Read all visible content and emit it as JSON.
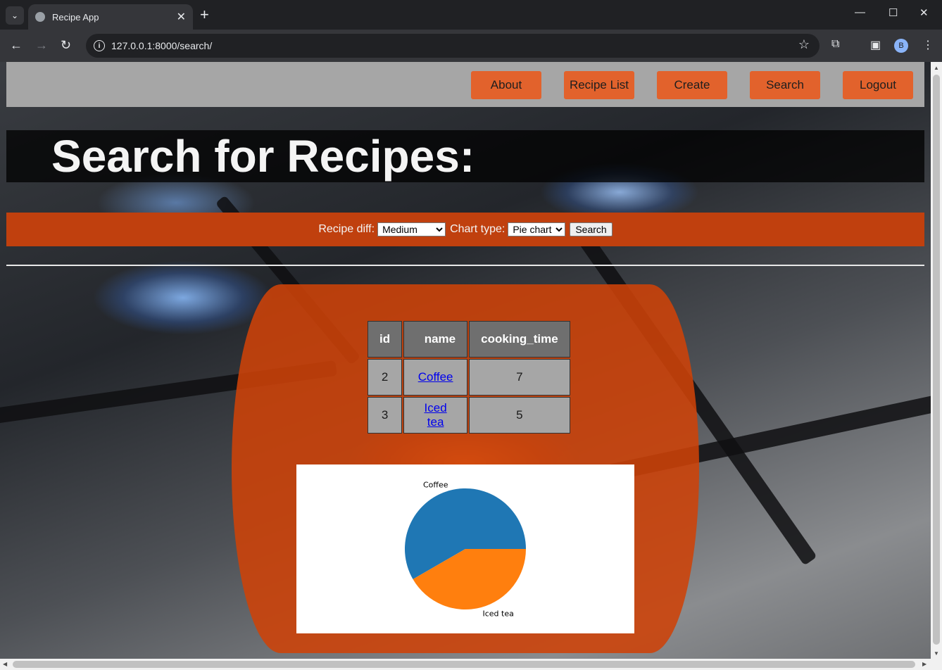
{
  "browser": {
    "tab_title": "Recipe App",
    "url": "127.0.0.1:8000/search/",
    "profile_initial": "B"
  },
  "nav": {
    "items": [
      "About",
      "Recipe List",
      "Create",
      "Search",
      "Logout"
    ]
  },
  "page": {
    "title": "Search for Recipes:"
  },
  "form": {
    "difficulty_label": "Recipe diff:",
    "difficulty_value": "Medium",
    "chart_label": "Chart type:",
    "chart_value": "Pie chart",
    "submit_label": "Search"
  },
  "results": {
    "columns": [
      "id",
      "name",
      "cooking_time"
    ],
    "rows": [
      {
        "id": "2",
        "name": "Coffee",
        "cooking_time": "7"
      },
      {
        "id": "3",
        "name": "Iced tea",
        "cooking_time": "5"
      }
    ]
  },
  "chart_data": {
    "type": "pie",
    "categories": [
      "Coffee",
      "Iced tea"
    ],
    "values": [
      7,
      5
    ],
    "colors": [
      "#1f77b4",
      "#ff7f0e"
    ]
  }
}
